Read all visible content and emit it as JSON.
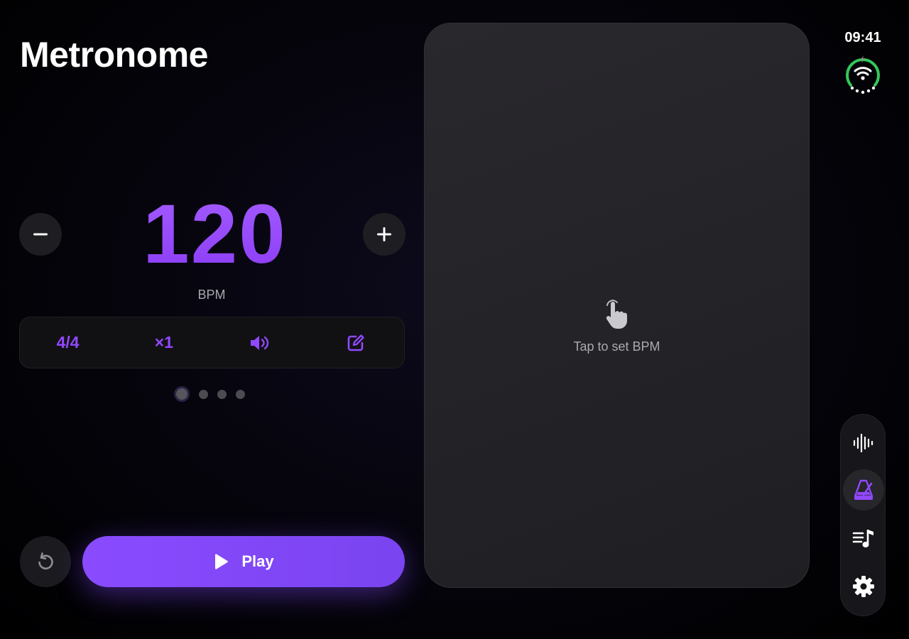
{
  "header": {
    "title": "Metronome"
  },
  "status": {
    "time": "09:41"
  },
  "tempo": {
    "value": "120",
    "unit_label": "BPM",
    "decrement_icon": "minus-icon",
    "increment_icon": "plus-icon"
  },
  "options": [
    {
      "label": "4/4",
      "icon": "time-signature"
    },
    {
      "label": "×1",
      "icon": "subdivision"
    },
    {
      "label": "",
      "icon": "speaker-icon"
    },
    {
      "label": "",
      "icon": "edit-icon"
    }
  ],
  "pager": {
    "count": 4,
    "active_index": 0
  },
  "controls": {
    "play_label": "Play",
    "reset_icon": "reset-icon"
  },
  "tap_panel": {
    "hint": "Tap to set BPM",
    "icon": "tap-hand-icon"
  },
  "dock": {
    "items": [
      {
        "name": "tuner",
        "icon": "waveform-icon",
        "active": false
      },
      {
        "name": "metronome",
        "icon": "metronome-icon",
        "active": true
      },
      {
        "name": "setlist",
        "icon": "music-list-icon",
        "active": false
      },
      {
        "name": "settings",
        "icon": "gear-icon",
        "active": false
      }
    ]
  },
  "colors": {
    "accent": "#9148ff",
    "play_button": "#8a4bff",
    "battery_ring": "#34c759"
  }
}
